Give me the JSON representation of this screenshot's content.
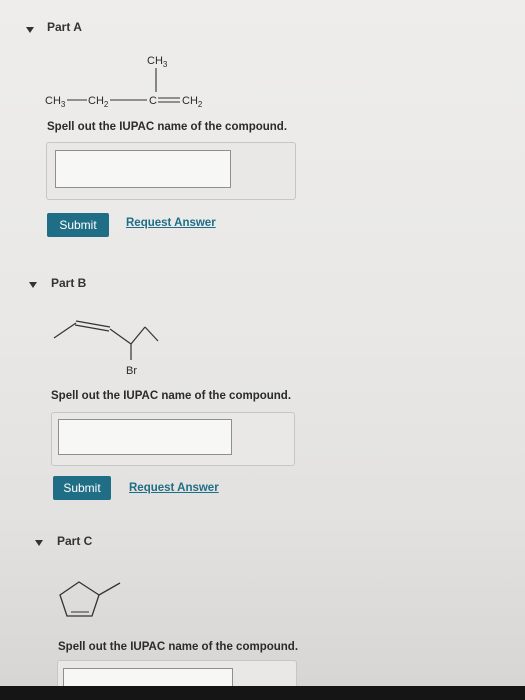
{
  "part_a": {
    "title": "Part A",
    "structure": {
      "methyl_label": "CH3",
      "chain": [
        "CH3",
        "CH2",
        "C",
        "CH2"
      ]
    },
    "question": "Spell out the IUPAC name of the compound.",
    "answer_value": "",
    "submit_label": "Submit",
    "request_label": "Request Answer"
  },
  "part_b": {
    "title": "Part B",
    "substituent_label": "Br",
    "question": "Spell out the IUPAC name of the compound.",
    "answer_value": "",
    "submit_label": "Submit",
    "request_label": "Request Answer"
  },
  "part_c": {
    "title": "Part C",
    "question": "Spell out the IUPAC name of the compound.",
    "answer_value": ""
  },
  "colors": {
    "accent": "#1f6e86",
    "background": "#eeedeb"
  }
}
